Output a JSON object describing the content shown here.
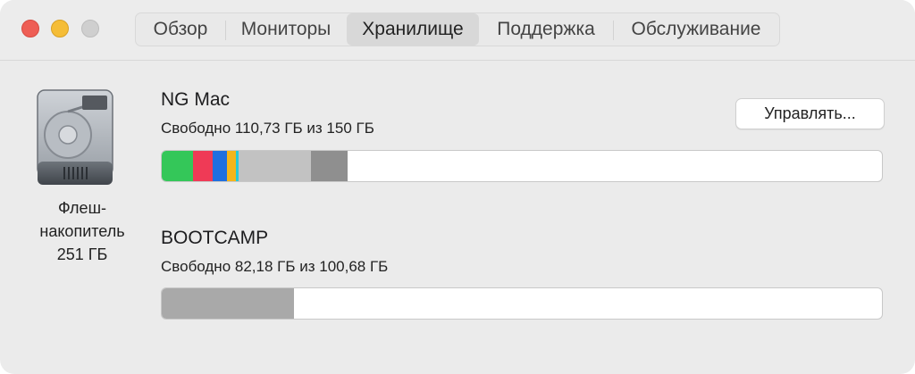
{
  "tabs": [
    {
      "label": "Обзор",
      "active": false
    },
    {
      "label": "Мониторы",
      "active": false
    },
    {
      "label": "Хранилище",
      "active": true
    },
    {
      "label": "Поддержка",
      "active": false
    },
    {
      "label": "Обслуживание",
      "active": false
    }
  ],
  "drive": {
    "icon": "hard-drive-icon",
    "label_line1": "Флеш-",
    "label_line2": "накопитель",
    "label_line3": "251 ГБ"
  },
  "volumes": [
    {
      "name": "NG Mac",
      "free_text": "Свободно 110,73 ГБ из 150 ГБ",
      "used_fraction": 0.2618,
      "segments": [
        {
          "category": "apps",
          "color": "#34c759",
          "fraction": 0.043
        },
        {
          "category": "documents",
          "color": "#ef3a56",
          "fraction": 0.028
        },
        {
          "category": "photos",
          "color": "#1f6fe0",
          "fraction": 0.019
        },
        {
          "category": "music",
          "color": "#f5b51a",
          "fraction": 0.013
        },
        {
          "category": "other-cyan",
          "color": "#27cbd6",
          "fraction": 0.004
        },
        {
          "category": "other",
          "color": "#c2c2c2",
          "fraction": 0.1
        },
        {
          "category": "system",
          "color": "#8f8f8f",
          "fraction": 0.051
        }
      ]
    },
    {
      "name": "BOOTCAMP",
      "free_text": "Свободно 82,18 ГБ из 100,68 ГБ",
      "used_fraction": 0.1838,
      "segments": [
        {
          "category": "used",
          "color": "#a9a9a9",
          "fraction": 0.1838
        }
      ]
    }
  ],
  "manage_button": {
    "label": "Управлять..."
  }
}
